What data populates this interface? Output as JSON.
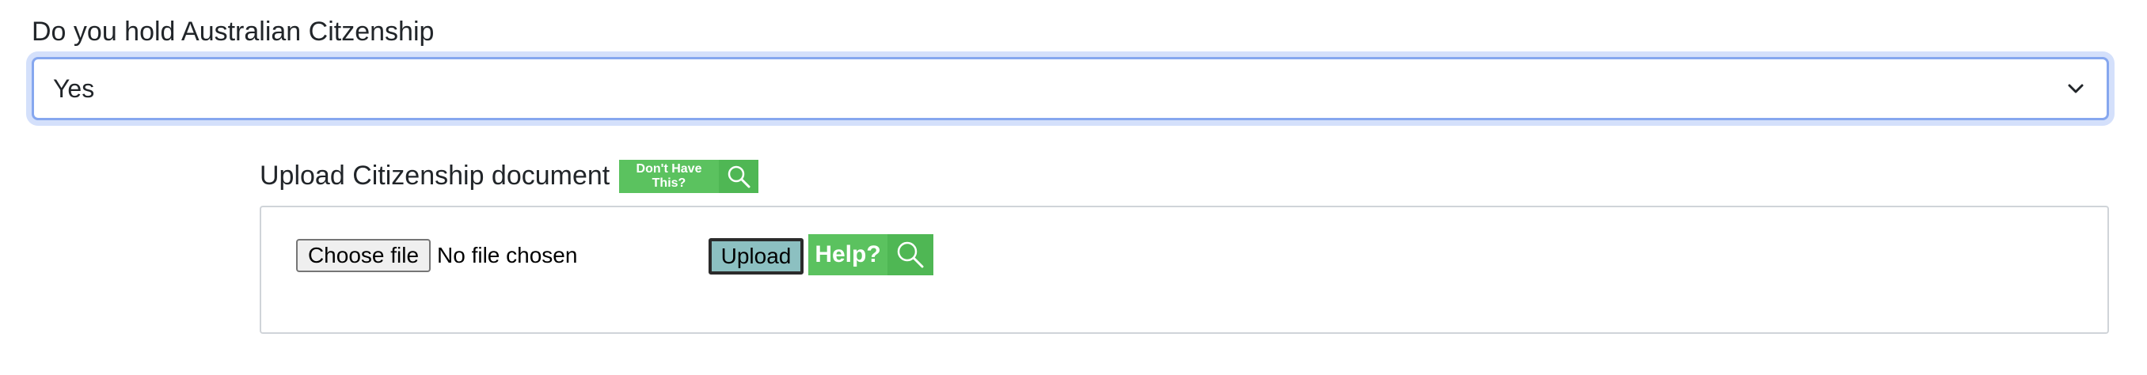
{
  "citizenship": {
    "question": "Do you hold Australian Citzenship",
    "selected_value": "Yes",
    "dropdown_icon": "chevron-down-icon"
  },
  "document_upload": {
    "label": "Upload Citizenship document",
    "dont_have_label": "Don't Have This?",
    "dont_have_icon": "search-icon",
    "choose_file_label": "Choose file",
    "file_status": "No file chosen",
    "upload_label": "Upload",
    "help_label": "Help?",
    "help_icon": "search-icon"
  },
  "colors": {
    "focus_border": "#86a7ef",
    "help_green": "#5bc25f",
    "upload_button": "#8cc0c1"
  }
}
